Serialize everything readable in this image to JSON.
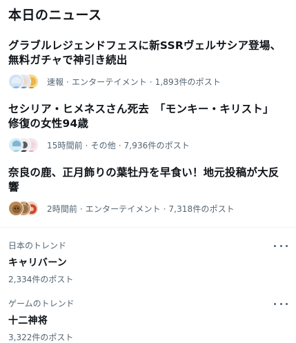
{
  "section": {
    "title": "本日のニュース"
  },
  "news": [
    {
      "headline": "グラブルレジェンドフェスに新SSRヴェルサシア登場、無料ガチャで神引き続出",
      "meta": "速報 · エンターテイメント · 1,893件のポスト"
    },
    {
      "headline": "セシリア・ヒメネスさん死去　「モンキー・キリスト」修復の女性94歳",
      "meta": "15時間前 · その他 · 7,936件のポスト"
    },
    {
      "headline": "奈良の鹿、正月飾りの葉牡丹を早食い！地元投稿が大反響",
      "meta": "2時間前 · エンターテイメント · 7,318件のポスト"
    }
  ],
  "trends": [
    {
      "context": "日本のトレンド",
      "name": "キャリバーン",
      "count": "2,334件のポスト"
    },
    {
      "context": "ゲームのトレンド",
      "name": "十二神将",
      "count": "3,322件のポスト"
    }
  ],
  "colors": {
    "text": "#0f1419",
    "secondary": "#536471",
    "divider": "#eff3f4"
  }
}
